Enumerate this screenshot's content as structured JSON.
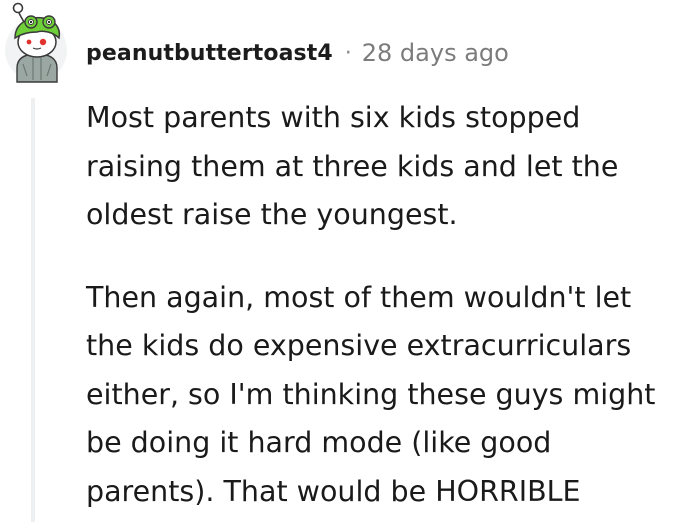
{
  "comment": {
    "author": {
      "username": "peanutbuttertoast4",
      "avatar_icon": "snoo-frog-hat-avatar-icon"
    },
    "separator": "·",
    "timestamp": "28 days ago",
    "paragraphs": [
      {
        "lines": [
          "Most parents with six kids stopped",
          "raising them at three kids and let the",
          "oldest raise the youngest."
        ]
      },
      {
        "lines": [
          "Then again, most of them wouldn't let",
          "the kids do expensive extracurriculars",
          "either, so I'm thinking these guys might",
          "be doing it hard mode (like good",
          "parents). That would be HORRIBLE"
        ]
      }
    ]
  },
  "colors": {
    "thread_line": "#edeff1",
    "username": "#1c1c1c",
    "timestamp": "#7c7c7c",
    "body_text": "#1a1a1b",
    "avatar_hat": "#6fcf39"
  }
}
